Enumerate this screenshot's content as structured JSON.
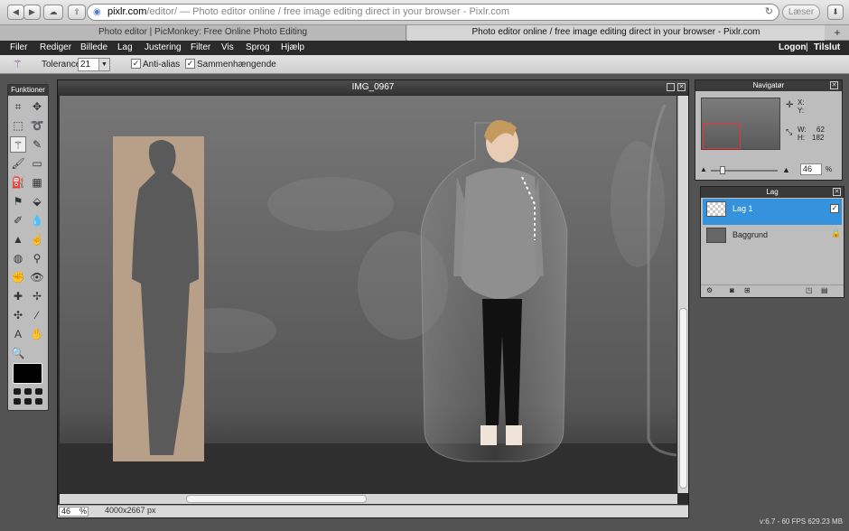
{
  "browser": {
    "url_host": "pixlr.com",
    "url_rest": "/editor/ — Photo editor online / free image editing direct in your browser - Pixlr.com",
    "reader_label": "Læser",
    "tabs": [
      {
        "label": "Photo editor | PicMonkey: Free Online Photo Editing",
        "active": false
      },
      {
        "label": "Photo editor online / free image editing direct in your browser - Pixlr.com",
        "active": true
      }
    ]
  },
  "menubar": {
    "items": [
      "Filer",
      "Rediger",
      "Billede",
      "Lag",
      "Justering",
      "Filter",
      "Vis",
      "Sprog",
      "Hjælp"
    ],
    "logon": "Logon",
    "separator": "|",
    "signup": "Tilslut"
  },
  "options": {
    "tolerance_label": "Tolerance:",
    "tolerance_value": "21",
    "antialias_label": "Anti-alias",
    "antialias_checked": true,
    "contiguous_label": "Sammenhængende",
    "contiguous_checked": true
  },
  "tools": {
    "title": "Funktioner",
    "icons": [
      "crop-icon",
      "move-icon",
      "marquee-icon",
      "lasso-icon",
      "magic-wand-icon",
      "pencil-icon",
      "brush-icon",
      "eraser-icon",
      "paint-bucket-icon",
      "gradient-icon",
      "clone-stamp-icon",
      "color-replace-icon",
      "drawing-icon",
      "blur-icon",
      "sharpen-icon",
      "smudge-icon",
      "sponge-icon",
      "dodge-icon",
      "burn-icon",
      "red-eye-icon",
      "spot-heal-icon",
      "bloat-icon",
      "pinch-icon",
      "color-picker-icon",
      "type-icon",
      "hand-icon",
      "zoom-icon"
    ]
  },
  "document": {
    "title": "IMG_0967",
    "zoom": "46",
    "zoom_unit": "%",
    "size": "4000x2667 px"
  },
  "navigator": {
    "title": "Navigatør",
    "x_label": "X:",
    "y_label": "Y:",
    "w_label": "W:",
    "w_value": "62",
    "h_label": "H:",
    "h_value": "182",
    "zoom": "46",
    "zoom_unit": "%"
  },
  "layers": {
    "title": "Lag",
    "items": [
      {
        "name": "Lag 1",
        "selected": true,
        "visible": true
      },
      {
        "name": "Baggrund",
        "selected": false,
        "locked": true
      }
    ]
  },
  "footer": {
    "version": "v:6.7 - 60 FPS 629.23 MB"
  }
}
